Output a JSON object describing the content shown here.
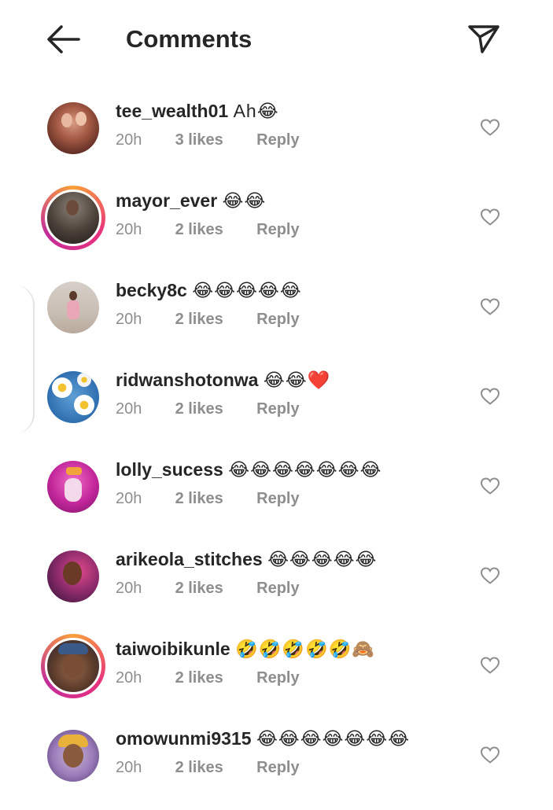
{
  "header": {
    "title": "Comments",
    "back_icon": "arrow-left-icon",
    "send_icon": "paper-plane-icon"
  },
  "comments": [
    {
      "username": "tee_wealth01",
      "text": "Ah😂",
      "time": "20h",
      "likes": "3 likes",
      "reply": "Reply",
      "story": false
    },
    {
      "username": "mayor_ever",
      "text": "😂😂",
      "time": "20h",
      "likes": "2 likes",
      "reply": "Reply",
      "story": true
    },
    {
      "username": "becky8c",
      "text": "😂😂😂😂😂",
      "time": "20h",
      "likes": "2 likes",
      "reply": "Reply",
      "story": false
    },
    {
      "username": "ridwanshotonwa",
      "text": "😂😂❤️",
      "time": "20h",
      "likes": "2 likes",
      "reply": "Reply",
      "story": false
    },
    {
      "username": "lolly_sucess",
      "text": "😂😂😂😂😂😂😂",
      "time": "20h",
      "likes": "2 likes",
      "reply": "Reply",
      "story": false
    },
    {
      "username": "arikeola_stitches",
      "text": "😂😂😂😂😂",
      "time": "20h",
      "likes": "2 likes",
      "reply": "Reply",
      "story": false
    },
    {
      "username": "taiwoibikunle",
      "text": "🤣🤣🤣🤣🤣🙈",
      "time": "20h",
      "likes": "2 likes",
      "reply": "Reply",
      "story": true
    },
    {
      "username": "omowunmi9315",
      "text": "😂😂😂😂😂😂😂",
      "time": "20h",
      "likes": "2 likes",
      "reply": "Reply",
      "story": false
    }
  ],
  "colors": {
    "text": "#262626",
    "secondary": "#8e8e8e",
    "story_ring": "#e8327e"
  }
}
